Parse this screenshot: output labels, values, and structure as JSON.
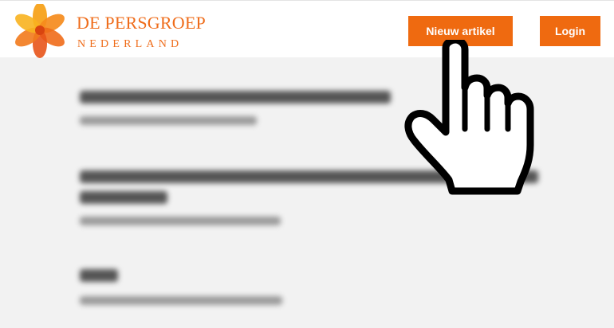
{
  "header": {
    "logo": {
      "line1": "DE PERSGROEP",
      "line2": "NEDERLAND"
    },
    "new_article_label": "Nieuw artikel",
    "login_label": "Login"
  },
  "colors": {
    "brand_orange": "#ef6a10",
    "page_background": "#f2f2f2",
    "header_background": "#ffffff"
  },
  "icons": {
    "logo_mark": "flower-icon",
    "pointer": "hand-pointer-icon"
  }
}
